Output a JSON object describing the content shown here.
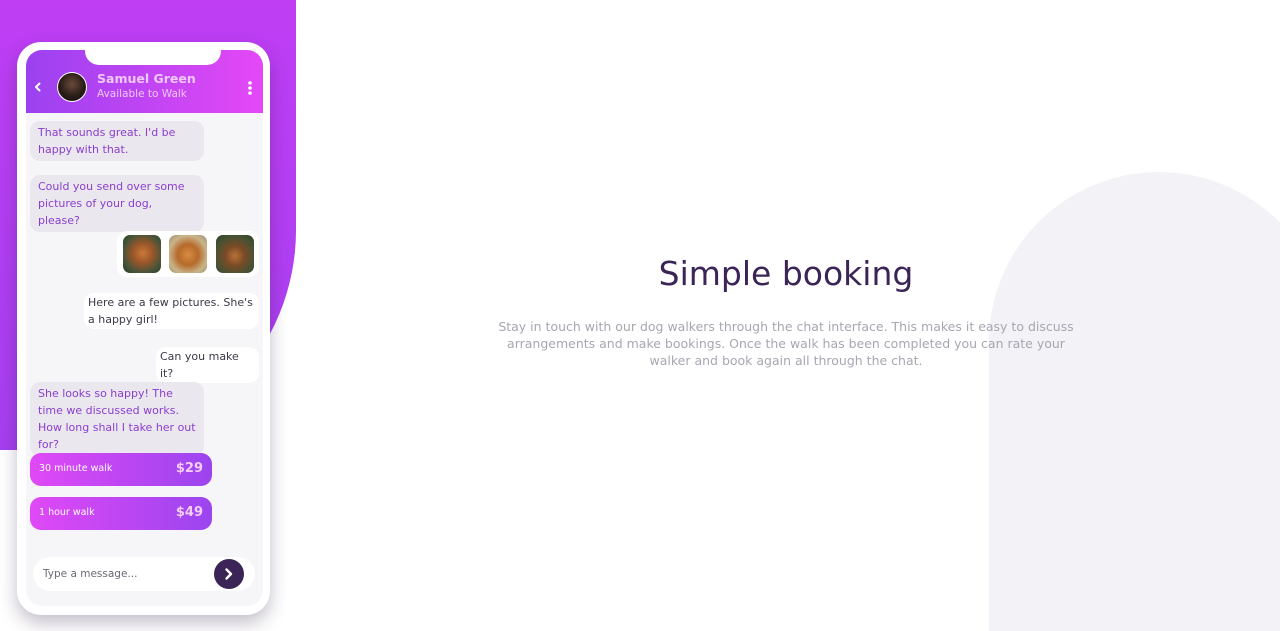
{
  "chat": {
    "contact_name": "Samuel Green",
    "contact_status": "Available to Walk",
    "back_icon": "chevron-left-icon",
    "more_icon": "vertical-dots-icon",
    "messages": [
      {
        "direction": "in",
        "text": "That sounds great. I'd be happy with that."
      },
      {
        "direction": "in",
        "text": "Could you send over some pictures of your dog, please?"
      },
      {
        "direction": "out",
        "text": "Here are a few pictures. She's a happy girl!"
      },
      {
        "direction": "out",
        "text": "Can you make it?"
      },
      {
        "direction": "in",
        "text": "She looks so happy! The time we discussed works. How long shall I take her out for?"
      }
    ],
    "options": [
      {
        "label": "30 minute walk",
        "price": "$29"
      },
      {
        "label": "1 hour walk",
        "price": "$49"
      }
    ],
    "composer": {
      "placeholder": "Type a message...",
      "send_icon": "chevron-right-icon"
    }
  },
  "hero": {
    "title": "Simple booking",
    "text": "Stay in touch with our dog walkers through the chat interface. This makes it easy to discuss arrangements and make bookings. Once the walk has been completed you can rate your walker and book again all through the chat."
  },
  "colors": {
    "accent_purple": "#a63ff0",
    "accent_pink": "#e448f6",
    "dark_purple": "#3b2556",
    "muted_text": "#a7a7b1",
    "arch_gray": "#f3f2f7"
  }
}
